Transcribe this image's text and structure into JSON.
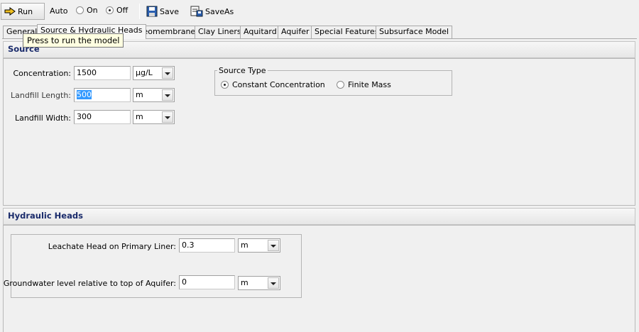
{
  "toolbar": {
    "run_label": "Run",
    "auto_label": "Auto",
    "on_label": "On",
    "off_label": "Off",
    "auto_mode": "Off",
    "save_label": "Save",
    "saveas_label": "SaveAs",
    "icons": [
      "run-arrow-icon",
      "save-disk-icon",
      "saveas-icon"
    ]
  },
  "tooltip": "Press to run the model",
  "tabs": [
    {
      "label": "General"
    },
    {
      "label": "Source & Hydraulic Heads",
      "active": true
    },
    {
      "label": "Geomembranes"
    },
    {
      "label": "Clay Liners"
    },
    {
      "label": "Aquitard"
    },
    {
      "label": "Aquifer"
    },
    {
      "label": "Special Features"
    },
    {
      "label": "Subsurface Model"
    }
  ],
  "source": {
    "heading": "Source",
    "concentration": {
      "label": "Concentration:",
      "value": "1500",
      "unit": "µg/L"
    },
    "landfill_length": {
      "label": "Landfill Length:",
      "value": "500",
      "unit": "m"
    },
    "landfill_width": {
      "label": "Landfill Width:",
      "value": "300",
      "unit": "m"
    },
    "source_type": {
      "title": "Source Type",
      "option1": "Constant Concentration",
      "option2": "Finite Mass",
      "selected": "Constant Concentration"
    }
  },
  "hydraulic": {
    "heading": "Hydraulic Heads",
    "leachate_head": {
      "label": "Leachate Head on Primary Liner:",
      "value": "0.3",
      "unit": "m"
    },
    "groundwater_level": {
      "label": "Groundwater level relative to top of Aquifer:",
      "value": "0",
      "unit": "m"
    }
  },
  "colors": {
    "heading_text": "#1a2b6b",
    "tooltip_bg": "#ffffe1",
    "selection": "#3399ff"
  }
}
